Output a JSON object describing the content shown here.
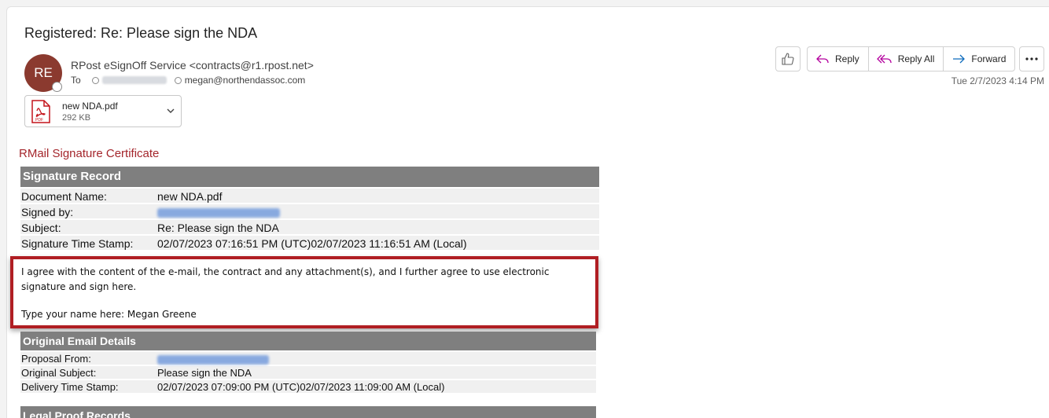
{
  "email": {
    "subject": "Registered: Re: Please sign the NDA",
    "avatar_initials": "RE",
    "sender": "RPost eSignOff Service <contracts@r1.rpost.net>",
    "to_label": "To",
    "recipient_visible": "megan@northendassoc.com",
    "timestamp": "Tue 2/7/2023 4:14 PM",
    "attachment": {
      "name": "new NDA.pdf",
      "size": "292 KB",
      "icon": "pdf-icon"
    }
  },
  "toolbar": {
    "like_icon": "thumbs-up-icon",
    "reply": "Reply",
    "reply_all": "Reply All",
    "forward": "Forward",
    "more_icon": "more-icon"
  },
  "certificate": {
    "title": "RMail Signature Certificate",
    "signature_record": {
      "heading": "Signature Record",
      "rows": [
        {
          "key": "Document Name:",
          "value": "new NDA.pdf"
        },
        {
          "key": "Signed by:",
          "value": ""
        },
        {
          "key": "Subject:",
          "value": "Re: Please sign the NDA"
        },
        {
          "key": "Signature Time Stamp:",
          "value": "02/07/2023 07:16:51 PM (UTC)02/07/2023 11:16:51 AM (Local)"
        }
      ]
    },
    "agreement": {
      "text": "I agree with the content of the e-mail, the contract and any attachment(s), and I further agree to use electronic signature and sign here.",
      "signature_line": "Type your name here: Megan Greene"
    },
    "original_email": {
      "heading": "Original Email Details",
      "rows": [
        {
          "key": "Proposal From:",
          "value": ""
        },
        {
          "key": "Original Subject:",
          "value": "Please sign the NDA"
        },
        {
          "key": "Delivery Time Stamp:",
          "value": "02/07/2023 07:09:00 PM (UTC)02/07/2023 11:09:00 AM (Local)"
        }
      ]
    },
    "legal_proof": {
      "heading": "Legal Proof Records"
    }
  },
  "colors": {
    "accent_red": "#a4262c",
    "highlight_border": "#b01e23",
    "avatar_bg": "#8b3a2f",
    "table_header": "#7f7f7f"
  }
}
